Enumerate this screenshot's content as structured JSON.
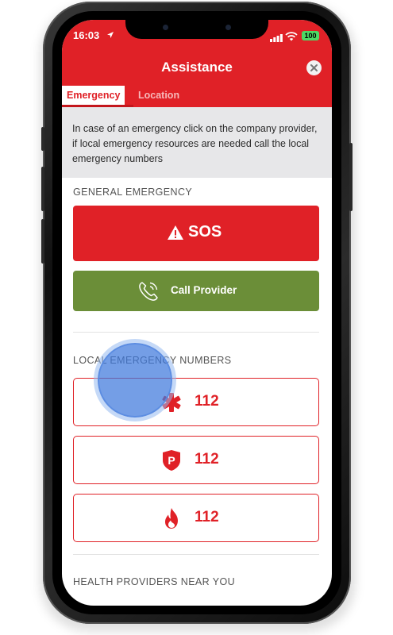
{
  "status_bar": {
    "time": "16:03",
    "battery": "100"
  },
  "header": {
    "title": "Assistance"
  },
  "tabs": [
    {
      "label": "Emergency",
      "active": true
    },
    {
      "label": "Location",
      "active": false
    }
  ],
  "info": {
    "text": "In case of an emergency click on the company provider, if local emergency resources are needed call the local emergency numbers"
  },
  "general_emergency": {
    "title": "GENERAL EMERGENCY",
    "sos_label": "SOS",
    "provider_label": "Call Provider"
  },
  "local_numbers": {
    "title": "LOCAL EMERGENCY NUMBERS",
    "items": [
      {
        "icon": "medical-star-icon",
        "number": "112"
      },
      {
        "icon": "police-badge-icon",
        "number": "112"
      },
      {
        "icon": "fire-icon",
        "number": "112"
      }
    ]
  },
  "health_providers": {
    "title": "HEALTH PROVIDERS NEAR YOU"
  },
  "colors": {
    "brand_red": "#e02127",
    "provider_green": "#6b8e38",
    "info_bg": "#e7e7e9",
    "touch_blue": "#3e78dc"
  }
}
